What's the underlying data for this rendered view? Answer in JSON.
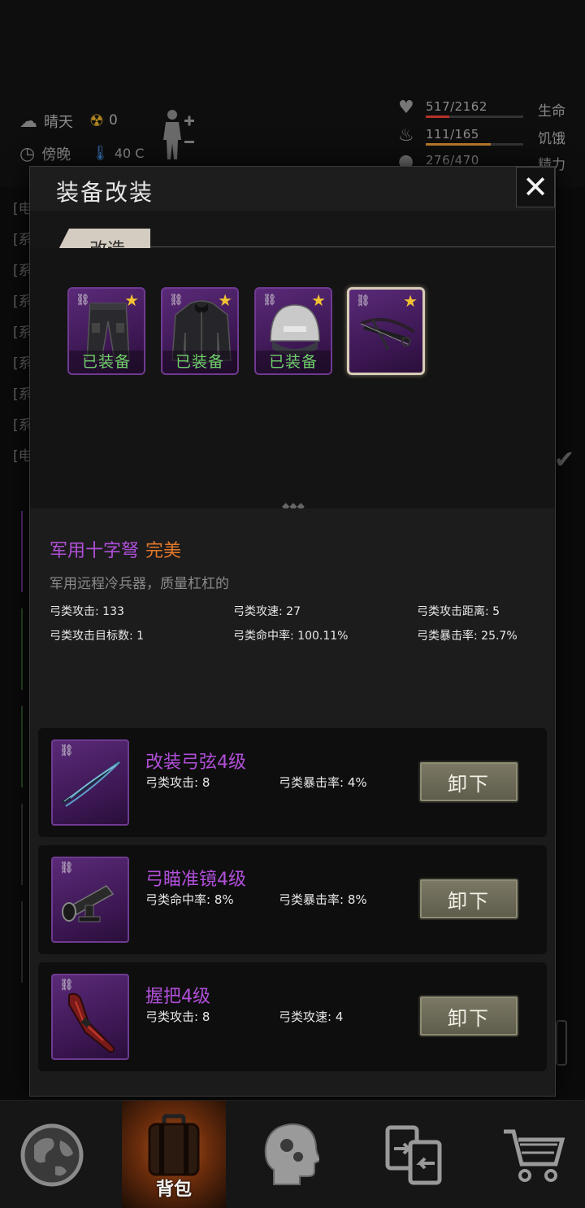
{
  "hud": {
    "weather": "晴天",
    "radiation": "0",
    "time_of_day": "傍晚",
    "temperature": "40 C",
    "stats": [
      {
        "icon": "heart-icon",
        "value": "517/2162",
        "label": "生命",
        "fraction": 0.24,
        "color": "#b8302a"
      },
      {
        "icon": "stomach-icon",
        "value": "111/165",
        "label": "饥饿",
        "fraction": 0.67,
        "color": "#b87a2a"
      },
      {
        "icon": "energy-icon",
        "value": "276/470",
        "label": "精力",
        "fraction": 0.59,
        "color": "#2a7ab8"
      }
    ],
    "log_lines": [
      "[电",
      "[系",
      "[系",
      "[系",
      "[系",
      "[系",
      "[系",
      "[系",
      "[电"
    ]
  },
  "modal": {
    "title": "装备改装",
    "close": "✕",
    "tab_active": "改造",
    "equipped_items": [
      {
        "name": "trousers",
        "status": "已装备"
      },
      {
        "name": "jacket",
        "status": "已装备"
      },
      {
        "name": "helmet",
        "status": "已装备"
      },
      {
        "name": "crossbow",
        "status": ""
      }
    ],
    "item": {
      "name": "军用十字弩",
      "quality": "完美",
      "description": "军用远程冷兵器，质量杠杠的",
      "stats": [
        "弓类攻击: 133",
        "弓类攻速: 27",
        "弓类攻击距离: 5",
        "弓类攻击目标数: 1",
        "弓类命中率: 100.11%",
        "弓类暴击率: 25.7%"
      ]
    },
    "mods": [
      {
        "name": "改装弓弦4级",
        "stat1": "弓类攻击: 8",
        "stat2": "弓类暴击率: 4%",
        "button": "卸下"
      },
      {
        "name": "弓瞄准镜4级",
        "stat1": "弓类命中率: 8%",
        "stat2": "弓类暴击率: 8%",
        "button": "卸下"
      },
      {
        "name": "握把4级",
        "stat1": "弓类攻击: 8",
        "stat2": "弓类攻速: 4",
        "button": "卸下"
      }
    ]
  },
  "nav": {
    "items": [
      {
        "icon": "globe-icon",
        "label": ""
      },
      {
        "icon": "backpack-icon",
        "label": "背包"
      },
      {
        "icon": "head-gears-icon",
        "label": ""
      },
      {
        "icon": "trade-icon",
        "label": ""
      },
      {
        "icon": "cart-icon",
        "label": ""
      }
    ]
  },
  "colors": {
    "rarity_purple": "#b04fd8",
    "quality_orange": "#e2782a",
    "equipped_green": "#6fd06a",
    "star_gold": "#f2c232"
  }
}
